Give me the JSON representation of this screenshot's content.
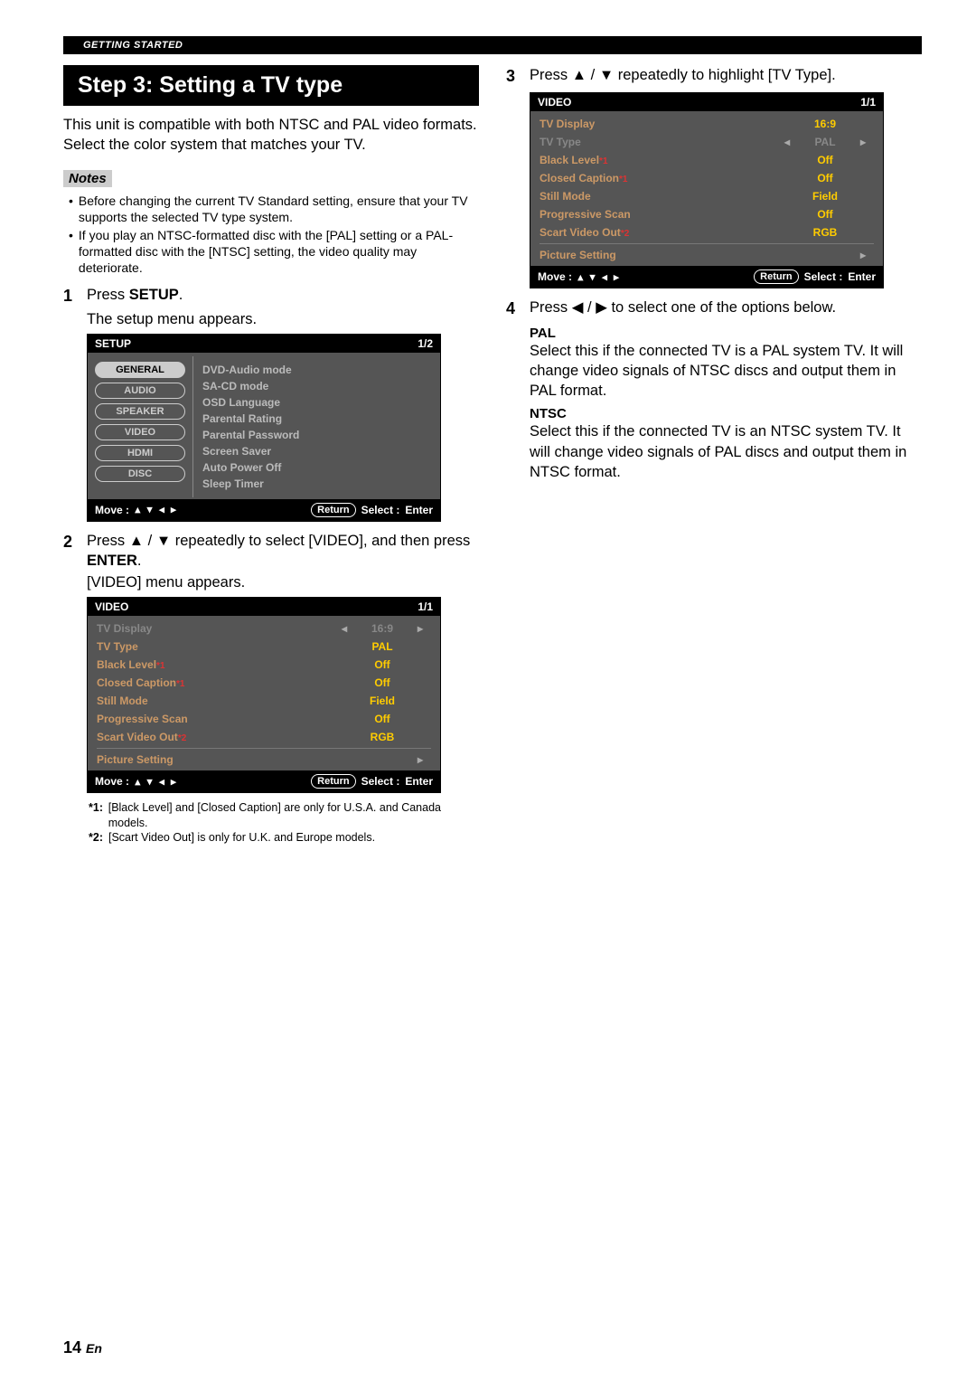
{
  "header": {
    "section": "GETTING STARTED"
  },
  "title": "Step 3: Setting a TV type",
  "intro": "This unit is compatible with both NTSC and PAL video formats. Select the color system that matches your TV.",
  "notes": {
    "label": "Notes",
    "items": [
      "Before changing the current TV Standard setting, ensure that your TV supports the selected TV type system.",
      "If you play an NTSC-formatted disc with the [PAL] setting or a PAL-formatted disc with the [NTSC] setting, the video quality may deteriorate."
    ]
  },
  "steps": {
    "s1": {
      "num": "1",
      "text_pre": "Press ",
      "text_bold": "SETUP",
      "text_post": ".",
      "sub": "The setup menu appears."
    },
    "s2": {
      "num": "2",
      "text": "Press ▲ / ▼ repeatedly to select [VIDEO], and then press ",
      "bold": "ENTER",
      "post": ".",
      "sub": "[VIDEO] menu appears."
    },
    "s3": {
      "num": "3",
      "text": "Press ▲ / ▼ repeatedly to highlight [TV Type]."
    },
    "s4": {
      "num": "4",
      "text": "Press ◀ / ▶ to select one of the options below."
    }
  },
  "setup_menu": {
    "title": "SETUP",
    "page": "1/2",
    "tabs": [
      "GENERAL",
      "AUDIO",
      "SPEAKER",
      "VIDEO",
      "HDMI",
      "DISC"
    ],
    "items": [
      "DVD-Audio mode",
      "SA-CD mode",
      "OSD Language",
      "Parental Rating",
      "Parental Password",
      "Screen Saver",
      "Auto Power Off",
      "Sleep Timer"
    ],
    "move": "Move :",
    "return": "Return",
    "select": "Select :",
    "enter": "Enter"
  },
  "video_menu": {
    "title": "VIDEO",
    "page": "1/1",
    "rows": [
      {
        "label": "TV Display",
        "val": "16:9",
        "sel": true
      },
      {
        "label": "TV Type",
        "val": "PAL"
      },
      {
        "label": "Black Level",
        "sup": "*1",
        "val": "Off"
      },
      {
        "label": "Closed Caption",
        "sup": "*1",
        "val": "Off"
      },
      {
        "label": "Still Mode",
        "val": "Field"
      },
      {
        "label": "Progressive Scan",
        "val": "Off"
      },
      {
        "label": "Scart Video Out",
        "sup": "*2",
        "val": "RGB"
      },
      {
        "label": "Picture Setting",
        "val": "",
        "arrow": true
      }
    ],
    "move": "Move :",
    "return": "Return",
    "select": "Select :",
    "enter": "Enter"
  },
  "video_menu2": {
    "title": "VIDEO",
    "page": "1/1",
    "rows": [
      {
        "label": "TV Display",
        "val": "16:9"
      },
      {
        "label": "TV Type",
        "val": "PAL",
        "sel": true
      },
      {
        "label": "Black Level",
        "sup": "*1",
        "val": "Off"
      },
      {
        "label": "Closed Caption",
        "sup": "*1",
        "val": "Off"
      },
      {
        "label": "Still Mode",
        "val": "Field"
      },
      {
        "label": "Progressive Scan",
        "val": "Off"
      },
      {
        "label": "Scart Video Out",
        "sup": "*2",
        "val": "RGB"
      },
      {
        "label": "Picture Setting",
        "val": "",
        "arrow": true
      }
    ]
  },
  "footnotes": {
    "f1": {
      "tag": "*1:",
      "text": "[Black Level] and [Closed Caption] are only for U.S.A. and Canada models."
    },
    "f2": {
      "tag": "*2:",
      "text": "[Scart Video Out] is only for U.K. and Europe models."
    }
  },
  "options": {
    "pal": {
      "head": "PAL",
      "body": "Select this if the connected TV is a PAL system TV. It will change video signals of NTSC discs and output them in PAL format."
    },
    "ntsc": {
      "head": "NTSC",
      "body": "Select this if the connected TV is an NTSC system TV. It will change video signals of PAL discs and output them in NTSC format."
    }
  },
  "pagenum": {
    "num": "14",
    "suffix": "En"
  },
  "glyph": {
    "up": "▲",
    "down": "▼",
    "left": "◀",
    "right": "▶",
    "tri_r": "▸",
    "tri_l": "◂"
  }
}
